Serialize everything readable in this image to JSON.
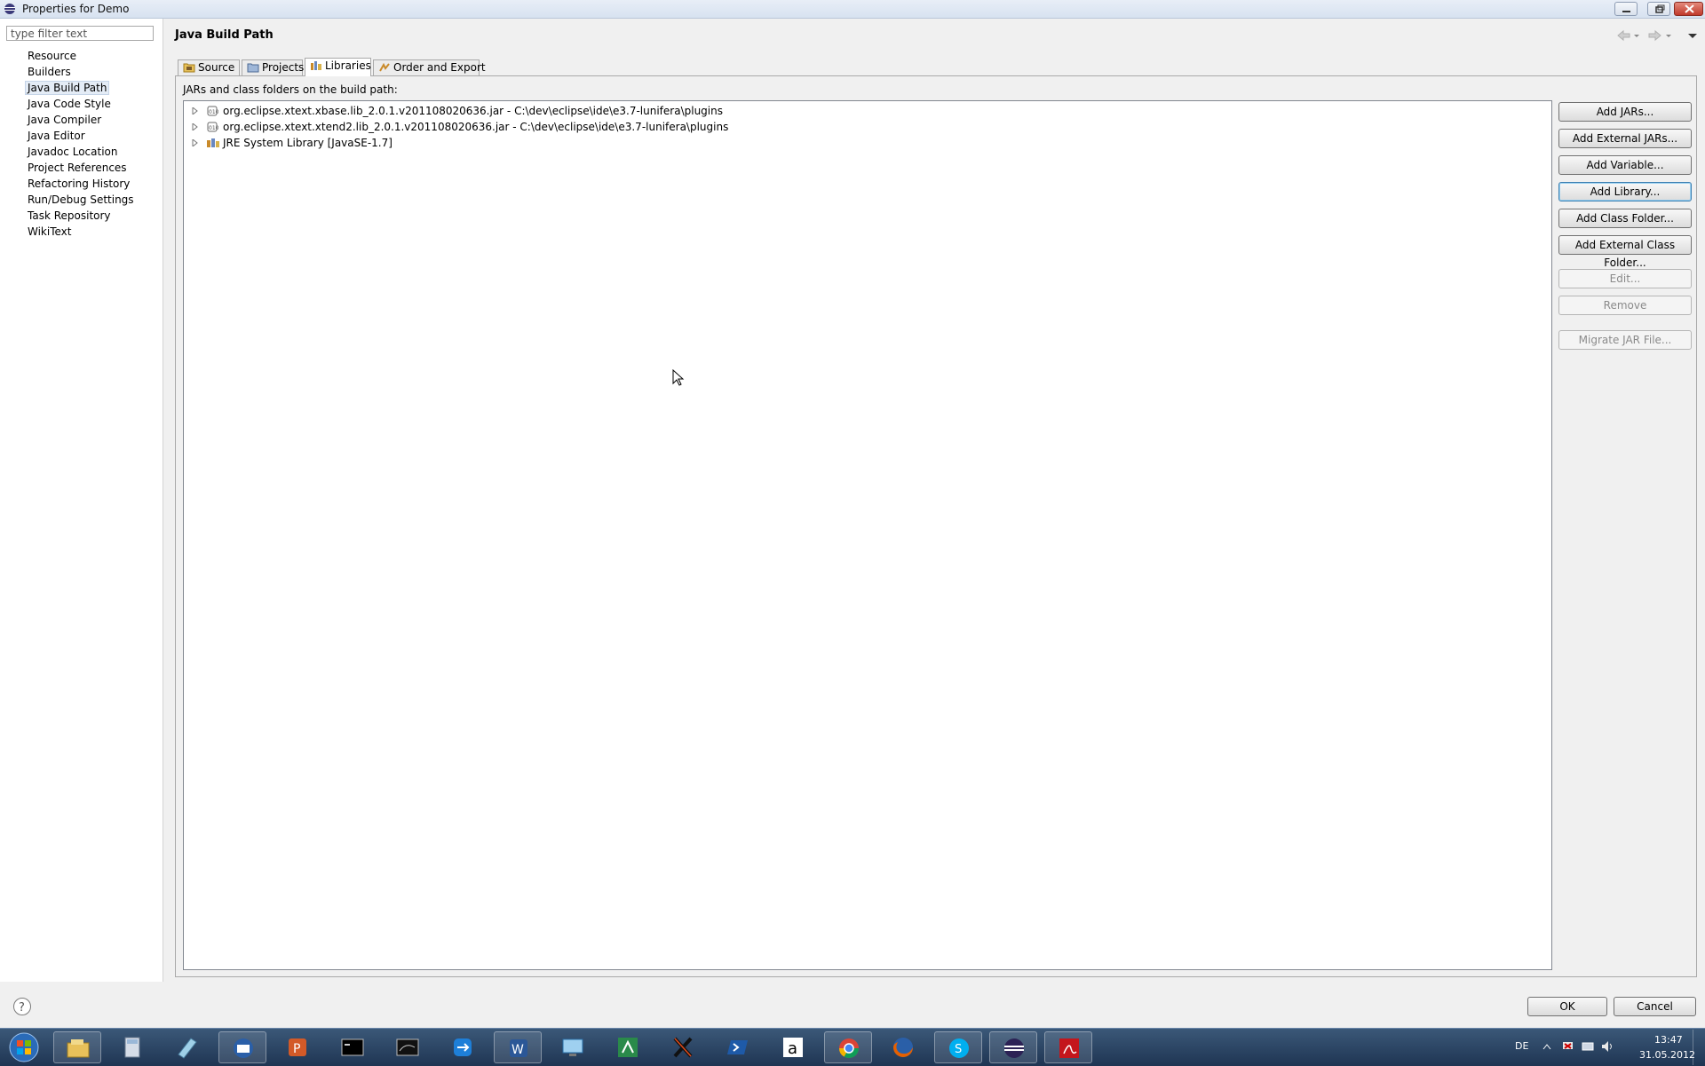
{
  "window": {
    "title": "Properties for Demo"
  },
  "filter": {
    "placeholder": "type filter text"
  },
  "nav": {
    "items": [
      {
        "label": "Resource",
        "selected": false
      },
      {
        "label": "Builders",
        "selected": false
      },
      {
        "label": "Java Build Path",
        "selected": true
      },
      {
        "label": "Java Code Style",
        "selected": false
      },
      {
        "label": "Java Compiler",
        "selected": false
      },
      {
        "label": "Java Editor",
        "selected": false
      },
      {
        "label": "Javadoc Location",
        "selected": false
      },
      {
        "label": "Project References",
        "selected": false
      },
      {
        "label": "Refactoring History",
        "selected": false
      },
      {
        "label": "Run/Debug Settings",
        "selected": false
      },
      {
        "label": "Task Repository",
        "selected": false
      },
      {
        "label": "WikiText",
        "selected": false
      }
    ]
  },
  "page": {
    "title": "Java Build Path"
  },
  "tabs": [
    {
      "label": "Source",
      "active": false
    },
    {
      "label": "Projects",
      "active": false
    },
    {
      "label": "Libraries",
      "active": true
    },
    {
      "label": "Order and Export",
      "active": false
    }
  ],
  "libraries": {
    "caption": "JARs and class folders on the build path:",
    "rows": [
      {
        "label": "org.eclipse.xtext.xbase.lib_2.0.1.v201108020636.jar - C:\\dev\\eclipse\\ide\\e3.7-lunifera\\plugins",
        "icon": "jar-icon"
      },
      {
        "label": "org.eclipse.xtext.xtend2.lib_2.0.1.v201108020636.jar - C:\\dev\\eclipse\\ide\\e3.7-lunifera\\plugins",
        "icon": "jar-icon"
      },
      {
        "label": "JRE System Library [JavaSE-1.7]",
        "icon": "library-icon"
      }
    ]
  },
  "side_buttons": {
    "add_jars": "Add JARs...",
    "add_external_jars": "Add External JARs...",
    "add_variable": "Add Variable...",
    "add_library": "Add Library...",
    "add_class_folder": "Add Class Folder...",
    "add_external_class_folder": "Add External Class Folder...",
    "edit": "Edit...",
    "remove": "Remove",
    "migrate_jar": "Migrate JAR File..."
  },
  "footer": {
    "ok": "OK",
    "cancel": "Cancel"
  },
  "taskbar": {
    "apps": [
      "explorer-icon",
      "calculator-icon",
      "notes-icon",
      "thunderbird-icon",
      "powerpoint-icon",
      "cmd-icon",
      "mysql-icon",
      "teamviewer-icon",
      "word-icon",
      "rdp-icon",
      "network-icon",
      "xming-icon",
      "powershell-icon",
      "amazon-icon",
      "chrome-icon",
      "firefox-icon",
      "skype-icon",
      "eclipse-icon",
      "acrobat-icon"
    ],
    "language": "DE",
    "time": "13:47",
    "date": "31.05.2012"
  },
  "colors": {
    "accent": "#3c7fb1",
    "selection": "#e4ecf6",
    "taskbar": "#2a4566"
  }
}
